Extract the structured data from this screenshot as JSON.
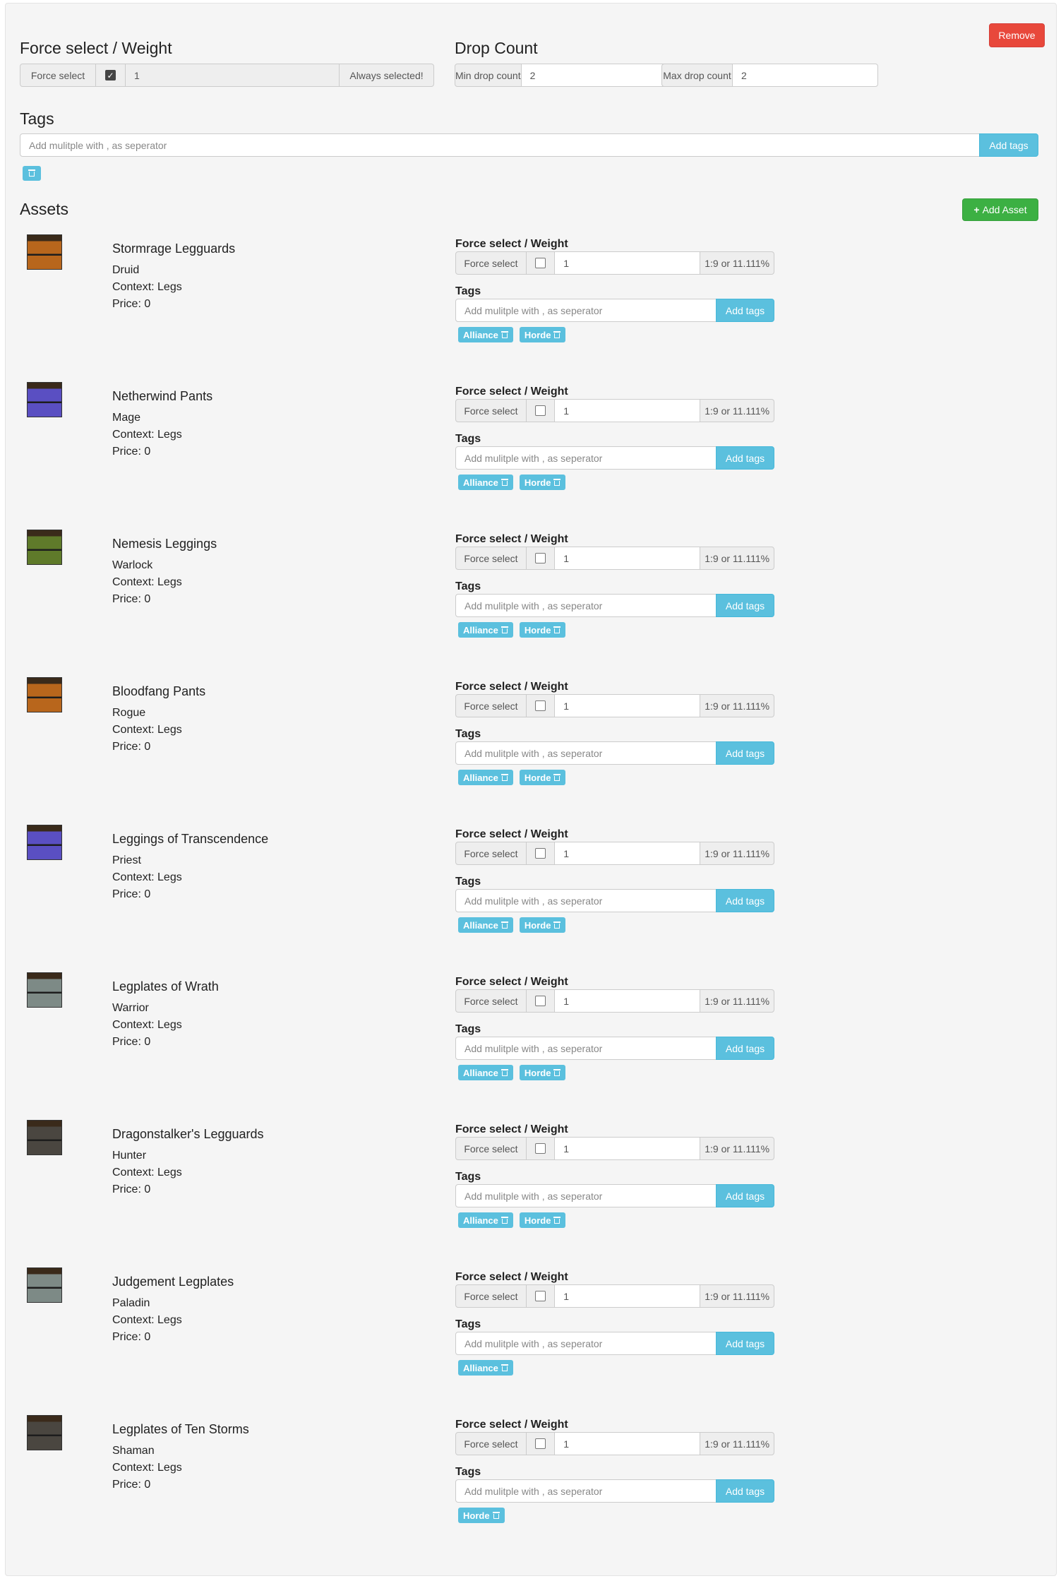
{
  "header": {
    "remove_label": "Remove",
    "force_select_heading": "Force select / Weight",
    "force_select_label": "Force select",
    "force_select_checked": true,
    "weight_value": "1",
    "always_selected_label": "Always selected!",
    "drop_count_heading": "Drop Count",
    "min_drop_label": "Min drop count",
    "min_drop_value": "2",
    "max_drop_label": "Max drop count",
    "max_drop_value": "2",
    "tags_heading": "Tags",
    "tags_placeholder": "Add mulitple with , as seperator",
    "add_tags_label": "Add tags"
  },
  "assets_section": {
    "heading": "Assets",
    "add_asset_label": "Add Asset"
  },
  "common": {
    "force_select_heading": "Force select / Weight",
    "force_select_label": "Force select",
    "tags_heading": "Tags",
    "tags_placeholder": "Add mulitple with , as seperator",
    "add_tags_label": "Add tags"
  },
  "colors": {
    "remove_button": "#e8483b",
    "add_asset_button": "#3cb043",
    "info_button": "#5bc0de"
  },
  "assets": [
    {
      "name": "Stormrage Legguards",
      "class": "Druid",
      "context": "Context: Legs",
      "price": "Price: 0",
      "weight": "1",
      "ratio": "1:9 or 11.111%",
      "tags": [
        "Alliance",
        "Horde"
      ],
      "icon": "orange-legs-icon",
      "icon_color": "#b8661c"
    },
    {
      "name": "Netherwind Pants",
      "class": "Mage",
      "context": "Context: Legs",
      "price": "Price: 0",
      "weight": "1",
      "ratio": "1:9 or 11.111%",
      "tags": [
        "Alliance",
        "Horde"
      ],
      "icon": "purple-legs-icon",
      "icon_color": "#5a4fc2"
    },
    {
      "name": "Nemesis Leggings",
      "class": "Warlock",
      "context": "Context: Legs",
      "price": "Price: 0",
      "weight": "1",
      "ratio": "1:9 or 11.111%",
      "tags": [
        "Alliance",
        "Horde"
      ],
      "icon": "green-legs-icon",
      "icon_color": "#5f7a2a"
    },
    {
      "name": "Bloodfang Pants",
      "class": "Rogue",
      "context": "Context: Legs",
      "price": "Price: 0",
      "weight": "1",
      "ratio": "1:9 or 11.111%",
      "tags": [
        "Alliance",
        "Horde"
      ],
      "icon": "orange-legs-icon",
      "icon_color": "#b8661c"
    },
    {
      "name": "Leggings of Transcendence",
      "class": "Priest",
      "context": "Context: Legs",
      "price": "Price: 0",
      "weight": "1",
      "ratio": "1:9 or 11.111%",
      "tags": [
        "Alliance",
        "Horde"
      ],
      "icon": "purple-legs-icon",
      "icon_color": "#5a4fc2"
    },
    {
      "name": "Legplates of Wrath",
      "class": "Warrior",
      "context": "Context: Legs",
      "price": "Price: 0",
      "weight": "1",
      "ratio": "1:9 or 11.111%",
      "tags": [
        "Alliance",
        "Horde"
      ],
      "icon": "plate-legs-icon",
      "icon_color": "#7d8a86"
    },
    {
      "name": "Dragonstalker's Legguards",
      "class": "Hunter",
      "context": "Context: Legs",
      "price": "Price: 0",
      "weight": "1",
      "ratio": "1:9 or 11.111%",
      "tags": [
        "Alliance",
        "Horde"
      ],
      "icon": "mail-legs-icon",
      "icon_color": "#4a4640"
    },
    {
      "name": "Judgement Legplates",
      "class": "Paladin",
      "context": "Context: Legs",
      "price": "Price: 0",
      "weight": "1",
      "ratio": "1:9 or 11.111%",
      "tags": [
        "Alliance"
      ],
      "icon": "plate-legs-icon",
      "icon_color": "#7d8a86"
    },
    {
      "name": "Legplates of Ten Storms",
      "class": "Shaman",
      "context": "Context: Legs",
      "price": "Price: 0",
      "weight": "1",
      "ratio": "1:9 or 11.111%",
      "tags": [
        "Horde"
      ],
      "icon": "mail-legs-icon",
      "icon_color": "#4a4640"
    }
  ]
}
